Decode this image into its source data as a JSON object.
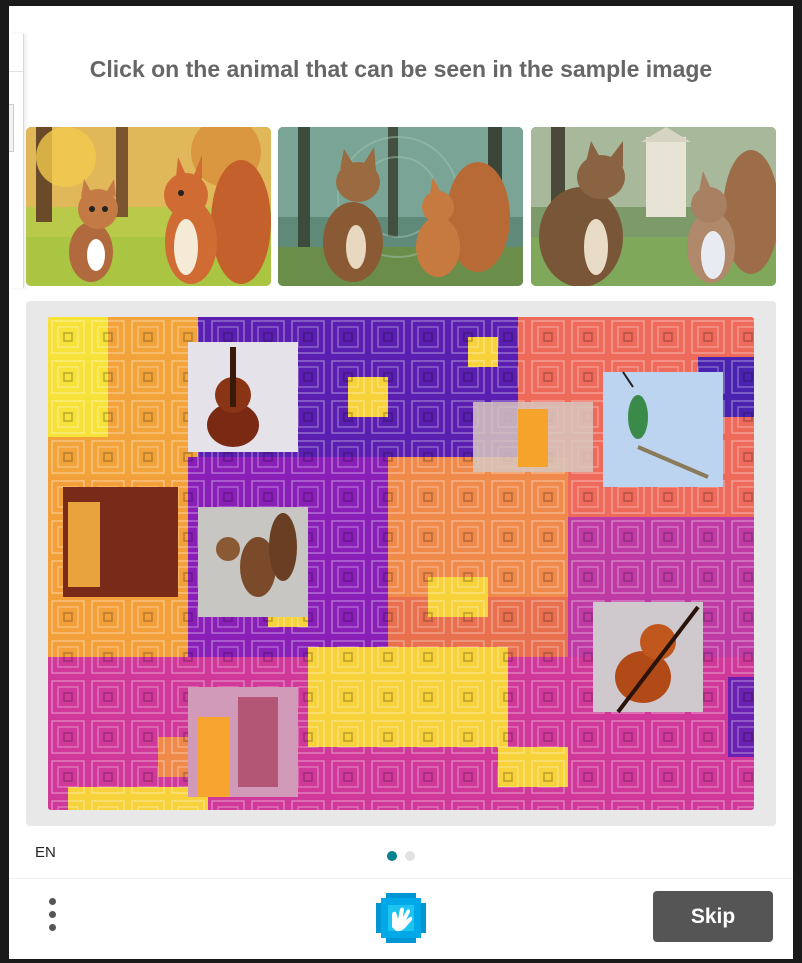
{
  "challenge": {
    "prompt": "Click on the animal that can be seen in the sample image"
  },
  "samples": [
    {
      "subject": "cartoon cat and squirrel in park"
    },
    {
      "subject": "cat and squirrel in forest"
    },
    {
      "subject": "cat and squirrel near building"
    }
  ],
  "task_objects": [
    "violin",
    "glass-of-juice",
    "hummingbird",
    "glass-of-juice",
    "squirrel",
    "violin",
    "glass-of-juice"
  ],
  "footer": {
    "language": "EN",
    "page_indicator": {
      "current": 1,
      "total": 2
    },
    "skip_label": "Skip"
  },
  "colors": {
    "accent": "#00838f",
    "skip_bg": "#555555",
    "prompt_text": "#666666",
    "logo": "#0096d6"
  }
}
